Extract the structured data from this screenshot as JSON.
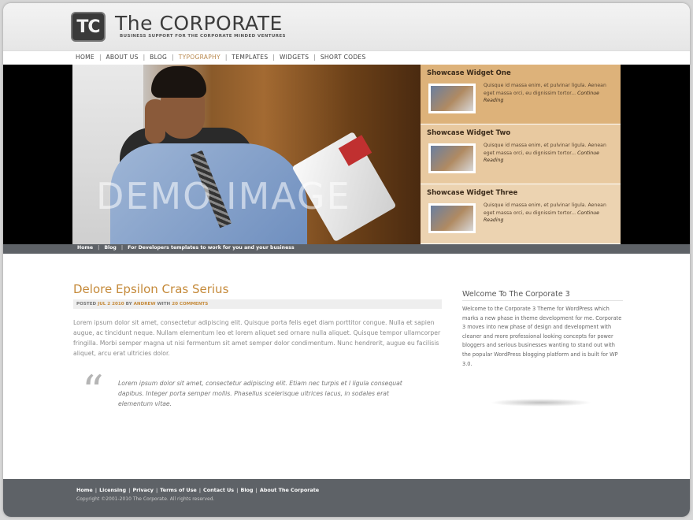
{
  "header": {
    "logo_mark": "TC",
    "title": "The CORPORATE",
    "tagline": "BUSINESS SUPPORT FOR THE CORPORATE MINDED VENTURES"
  },
  "nav": {
    "items": [
      {
        "label": "HOME"
      },
      {
        "label": "ABOUT US"
      },
      {
        "label": "BLOG"
      },
      {
        "label": "TYPOGRAPHY",
        "active": true
      },
      {
        "label": "TEMPLATES"
      },
      {
        "label": "WIDGETS"
      },
      {
        "label": "SHORT CODES"
      }
    ],
    "active_color": "#b9894f"
  },
  "hero": {
    "demo_text": "DEMO IMAGE"
  },
  "widgets": [
    {
      "title": "Showcase Widget One",
      "text": "Quisque id massa enim, et pulvinar ligula. Aenean eget massa orci, eu dignissim tortor...",
      "link": "Continue Reading"
    },
    {
      "title": "Showcase Widget Two",
      "text": "Quisque id massa enim, et pulvinar ligula. Aenean eget massa orci, eu dignissim tortor...",
      "link": "Continue Reading"
    },
    {
      "title": "Showcase Widget Three",
      "text": "Quisque id massa enim, et pulvinar ligula. Aenean eget massa orci, eu dignissim tortor...",
      "link": "Continue Reading"
    }
  ],
  "breadcrumb": {
    "items": [
      "Home",
      "Blog",
      "For Developers templates to work for you and your business"
    ]
  },
  "post": {
    "title": "Delore Epsilon Cras Serius",
    "meta_posted": "POSTED ",
    "meta_date": "JUL 2 2010",
    "meta_by": " BY ",
    "meta_author": "ANDREW",
    "meta_with": " WITH ",
    "meta_comments": "20 COMMENTS",
    "body": "Lorem ipsum dolor sit amet, consectetur adipiscing elit. Quisque porta felis eget diam porttitor congue. Nulla et sapien augue, ac tincidunt neque. Nullam elementum leo et lorem aliquet sed ornare nulla aliquet. Quisque tempor ullamcorper fringilla. Morbi semper magna ut nisi fermentum sit amet semper dolor condimentum. Nunc hendrerit, augue eu facilisis aliquet, arcu erat ultricies dolor.",
    "quote": "Lorem ipsum dolor sit amet, consectetur adipiscing elit. Etiam nec turpis et l ligula consequat dapibus. Integer porta semper mollis. Phasellus scelerisque ultrices lacus, in sodales erat elementum vitae."
  },
  "sidebar": {
    "title": "Welcome To The Corporate 3",
    "text": "Welcome to the Corporate 3 Theme for WordPress which marks a new phase in theme development for me. Corporate 3 moves into new phase of design and development with cleaner and more professional looking concepts for power bloggers and serious businesses wanting to stand out with the popular WordPress blogging platform and is built for WP 3.0."
  },
  "footer": {
    "links": [
      "Home",
      "Licensing",
      "Privacy",
      "Terms of Use",
      "Contact Us",
      "Blog",
      "About The Corporate"
    ],
    "copyright": "Copyright ©2001-2010 The Corporate. All rights reserved."
  },
  "colors": {
    "accent": "#c58a3a",
    "bar": "#5e6267",
    "widget_1": "#ddb27a",
    "widget_2": "#e8c9a0",
    "widget_3": "#ecd3b1"
  }
}
